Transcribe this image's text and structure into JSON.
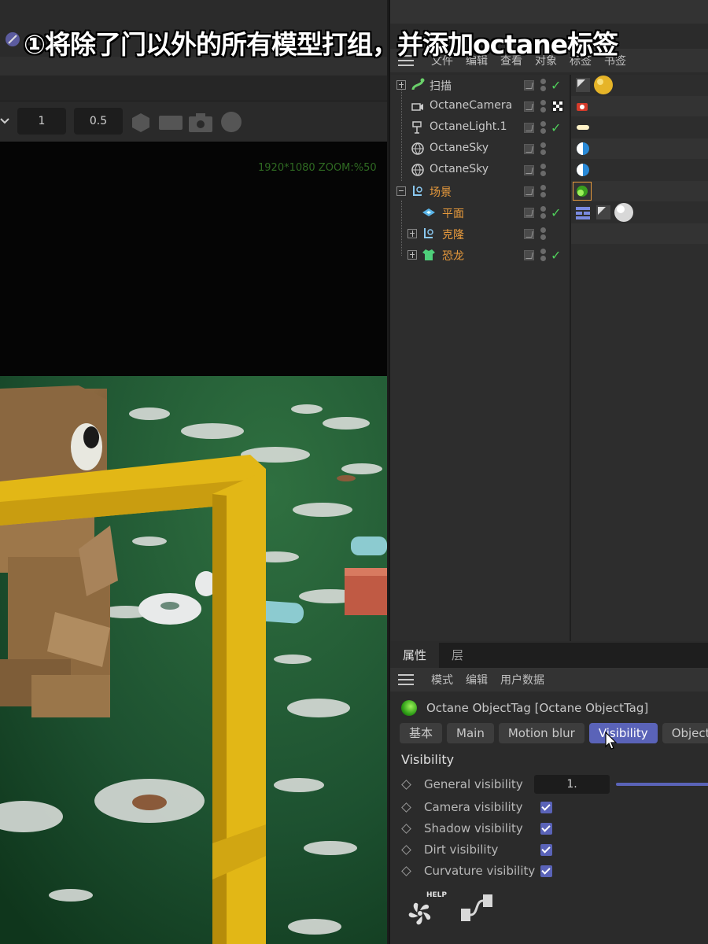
{
  "caption": "①将除了门以外的所有模型打组，并添加octane标签",
  "viewport": {
    "toolbar_value_1": "1",
    "toolbar_value_2": "0.5",
    "resolution_text": "1920*1080 ZOOM:%50"
  },
  "object_manager": {
    "menu": [
      "文件",
      "编辑",
      "查看",
      "对象",
      "标签",
      "书签"
    ],
    "objects": [
      {
        "name": "扫描",
        "icon": "sweep-icon",
        "check": true
      },
      {
        "name": "OctaneCamera",
        "icon": "camera-icon",
        "check": false
      },
      {
        "name": "OctaneLight.1",
        "icon": "light-icon",
        "check": true
      },
      {
        "name": "OctaneSky",
        "icon": "sky-icon",
        "check": false
      },
      {
        "name": "OctaneSky",
        "icon": "sky-icon",
        "check": false
      },
      {
        "name": "场景",
        "icon": "null-group-icon",
        "check": false
      },
      {
        "name": "平面",
        "icon": "plane-icon",
        "check": true
      },
      {
        "name": "克隆",
        "icon": "null-group-icon",
        "check": false
      },
      {
        "name": "恐龙",
        "icon": "tshirt-icon",
        "check": true
      }
    ]
  },
  "attributes": {
    "tabs": [
      "属性",
      "层"
    ],
    "menu": [
      "模式",
      "编辑",
      "用户数据"
    ],
    "tag_title": "Octane ObjectTag [Octane ObjectTag]",
    "sub_tabs": [
      "基本",
      "Main",
      "Motion blur",
      "Visibility",
      "Object"
    ],
    "active_sub_tab": "Visibility",
    "section_title": "Visibility",
    "general_visibility_label": "General visibility",
    "general_visibility_value": "1.",
    "checkbox_params": [
      {
        "label": "Camera visibility",
        "checked": true
      },
      {
        "label": "Shadow visibility",
        "checked": true
      },
      {
        "label": "Dirt visibility",
        "checked": true
      },
      {
        "label": "Curvature visibility",
        "checked": true
      }
    ],
    "help_badge": "HELP"
  },
  "colors": {
    "accent": "#5a63b8",
    "check_green": "#4fcf5a",
    "group_orange": "#e89a3c"
  }
}
